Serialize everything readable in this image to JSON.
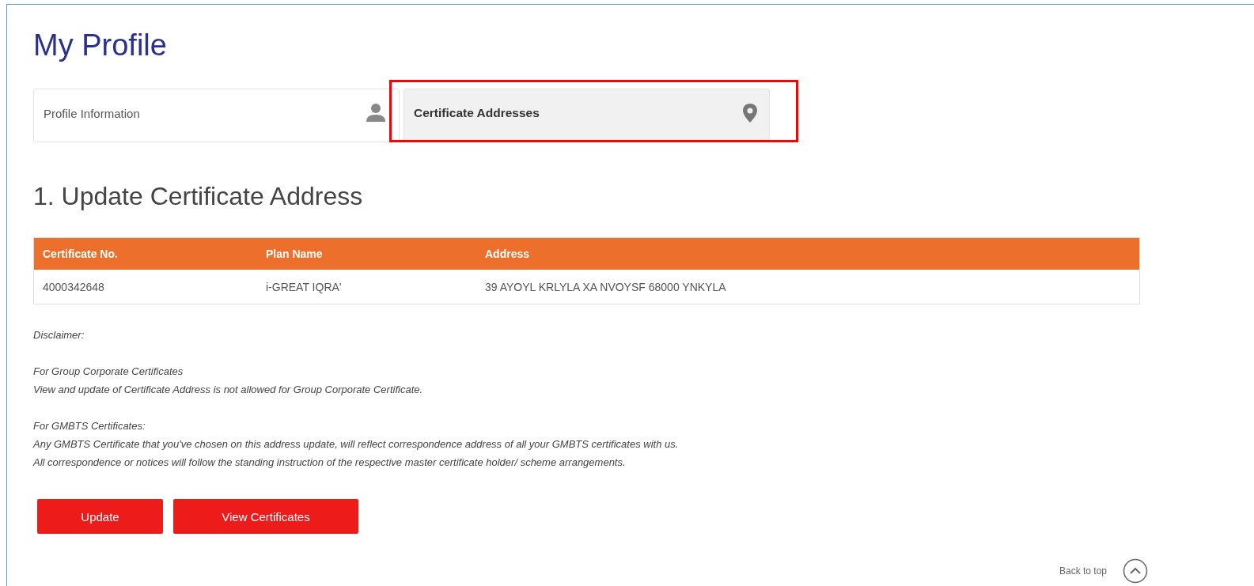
{
  "page": {
    "title": "My Profile"
  },
  "tabs": [
    {
      "label": "Profile Information",
      "kind": "person",
      "selected": false,
      "highlighted": false
    },
    {
      "label": "Certificate Addresses",
      "kind": "pin",
      "selected": true,
      "highlighted": true
    }
  ],
  "section": {
    "heading": "1. Update Certificate Address"
  },
  "table": {
    "columns": [
      "Certificate No.",
      "Plan Name",
      "Address"
    ],
    "rows": [
      [
        "4000342648",
        "i-GREAT IQRA'",
        "39 AYOYL KRLYLA XA NVOYSF 68000 YNKYLA"
      ]
    ]
  },
  "disclaimer": {
    "label": "Disclaimer:",
    "sections": [
      {
        "title": "For Group Corporate Certificates",
        "lines": [
          "View and update of Certificate Address is not allowed for Group Corporate Certificate."
        ]
      },
      {
        "title": "For GMBTS Certificates:",
        "lines": [
          "Any GMBTS Certificate that you've chosen on this address update, will reflect correspondence address of all your GMBTS certificates with us.",
          "All correspondence or notices will follow the standing instruction of the respective master certificate holder/ scheme arrangements."
        ]
      }
    ]
  },
  "buttons": [
    "Update",
    "View Certificates"
  ],
  "back_to_top": "Back to top"
}
